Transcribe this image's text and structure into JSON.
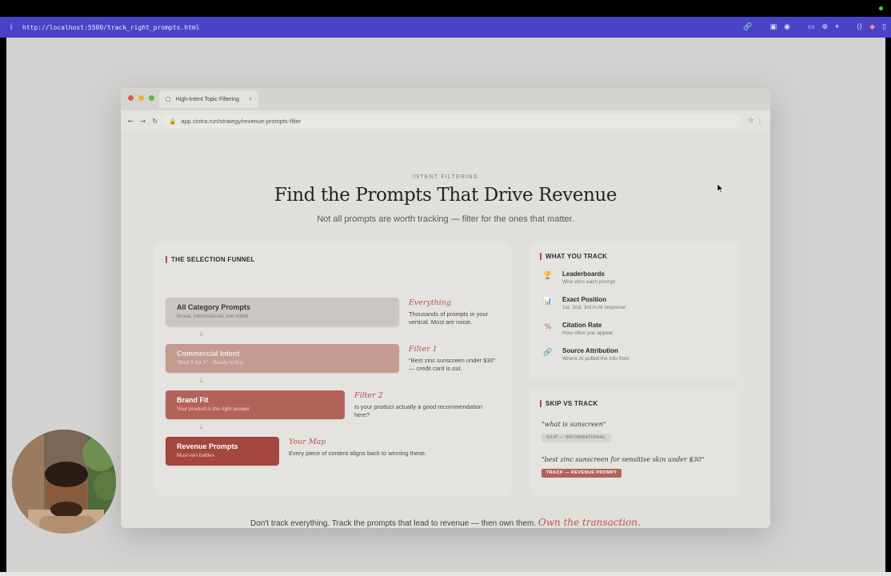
{
  "outer_browser": {
    "info_glyph": "i",
    "url": "http://localhost:5500/track_right_prompts.html",
    "tool_icons": [
      "link-icon",
      "reader-icon",
      "camera-icon",
      "cast-icon",
      "globe-icon",
      "crosshair-icon",
      "code-icon",
      "extension-icon",
      "sidebar-icon"
    ]
  },
  "window": {
    "tab_title": "High-Intent Topic Filtering",
    "tab_close": "×",
    "address": "app.cintra.run/strategy/revenue-prompts-filter",
    "nav": "← → ↻",
    "star": "☆",
    "more": "⋮"
  },
  "hero": {
    "eyebrow": "INTENT FILTERING",
    "title": "Find the Prompts That Drive Revenue",
    "subtitle": "Not all prompts are worth tracking — filter for the ones that matter."
  },
  "funnel": {
    "title": "THE SELECTION FUNNEL",
    "arrow": "↓",
    "stages": [
      {
        "title": "All Category Prompts",
        "sub": "Broad, informational, low intent",
        "note_head": "Everything",
        "note": "Thousands of prompts in your vertical. Most are noise."
      },
      {
        "title": "Commercial Intent",
        "sub": "\"Best X for Y\" - Ready to buy",
        "note_head": "Filter 1",
        "note": "\"Best zinc sunscreen under $30\" — credit card is out."
      },
      {
        "title": "Brand Fit",
        "sub": "Your product is the right answer",
        "note_head": "Filter 2",
        "note": "Is your product actually a good recommendation here?"
      },
      {
        "title": "Revenue Prompts",
        "sub": "Must-win battles",
        "note_head": "Your Map",
        "note": "Every piece of content aligns back to winning these."
      }
    ]
  },
  "track": {
    "title": "WHAT YOU TRACK",
    "items": [
      {
        "icon": "🏆",
        "name": "Leaderboards",
        "desc": "Who wins each prompt"
      },
      {
        "icon": "📊",
        "name": "Exact Position",
        "desc": "1st, 2nd, 3rd in AI response"
      },
      {
        "icon": "%",
        "name": "Citation Rate",
        "desc": "How often you appear"
      },
      {
        "icon": "🔗",
        "name": "Source Attribution",
        "desc": "Where AI pulled the info from"
      }
    ]
  },
  "skip": {
    "title": "SKIP VS TRACK",
    "examples": [
      {
        "quote": "\"what is sunscreen\"",
        "pill": "SKIP — INFORMATIONAL"
      },
      {
        "quote": "\"best zinc sunscreen for sensitive skin under $30\"",
        "pill": "TRACK — REVENUE PROMPT"
      }
    ]
  },
  "footer": {
    "text": "Don't track everything. Track the prompts that lead to revenue — then own them.",
    "accent": "Own the transaction."
  },
  "colors": {
    "outer_bar": "#4a43c8",
    "accent": "#b6534a",
    "stage_revenue": "#a3473f"
  }
}
